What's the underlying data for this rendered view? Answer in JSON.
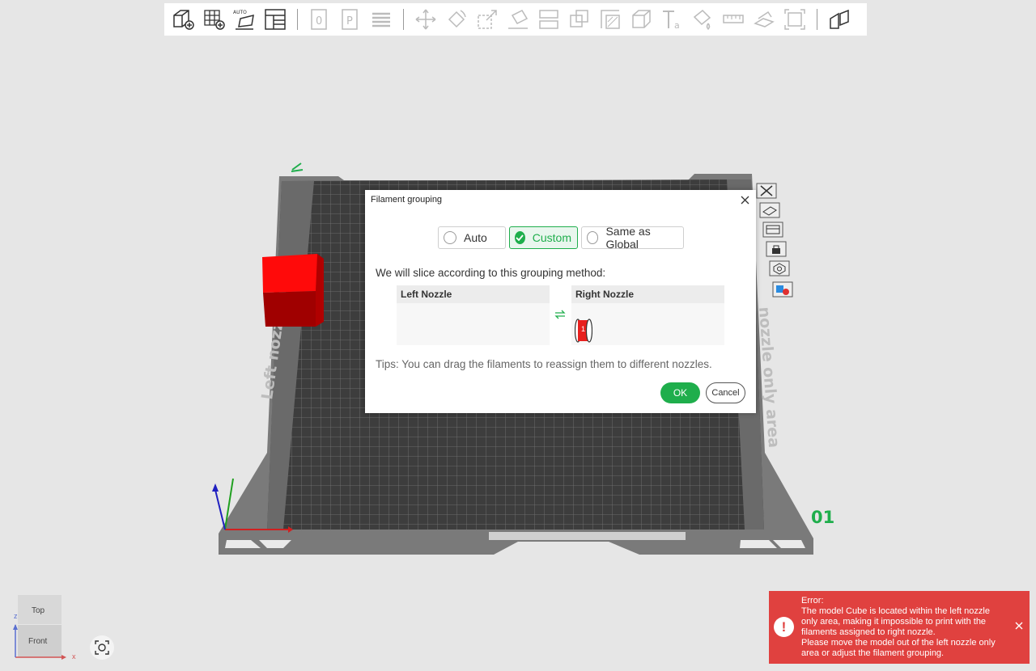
{
  "toolbar": {
    "items": [
      "add-object-icon",
      "add-plate-icon",
      "auto-arrange-icon",
      "layout-icon",
      "placeholder-0-icon",
      "placeholder-p-icon",
      "stack-icon",
      "move-icon",
      "rotate-icon",
      "scale-icon",
      "lay-on-face-icon",
      "cut-icon",
      "boolean-icon",
      "support-paint-icon",
      "seam-paint-icon",
      "text-icon",
      "color-paint-icon",
      "measure-icon",
      "assembly-icon",
      "fit-icon",
      "split-icon"
    ]
  },
  "plate": {
    "left_label": "Left nozzle",
    "right_label": "nozzle only area",
    "number": "01"
  },
  "dialog": {
    "title": "Filament grouping",
    "options": [
      "Auto",
      "Custom",
      "Same as Global"
    ],
    "selected": "Custom",
    "method_text": "We will slice according to this grouping method:",
    "left_nozzle": "Left Nozzle",
    "right_nozzle": "Right Nozzle",
    "filament": {
      "number": "1",
      "color": "#e8201e"
    },
    "tips": "Tips: You can drag the filaments to reassign them to different nozzles.",
    "ok": "OK",
    "cancel": "Cancel"
  },
  "viewcube": {
    "top": "Top",
    "front": "Front",
    "axis_x": "x",
    "axis_z": "z"
  },
  "error": {
    "title": "Error:",
    "line1": "The model Cube is located within the left nozzle only area, making it impossible to print with the filaments assigned to right nozzle.",
    "line2": "Please move the model out of the left nozzle only area or adjust the filament grouping."
  },
  "colors": {
    "accent": "#1fae4c",
    "error": "#e0413f",
    "cube": "#ee1111"
  }
}
